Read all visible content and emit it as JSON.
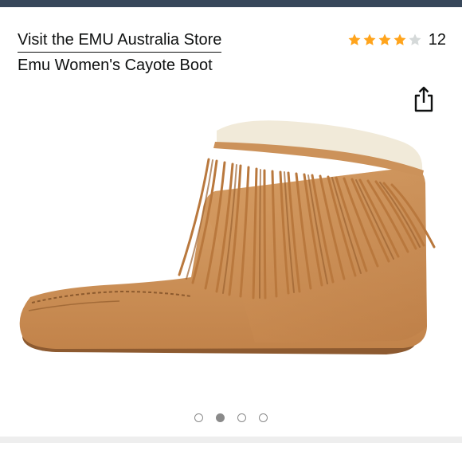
{
  "store": {
    "link_label": "Visit the EMU Australia Store"
  },
  "product": {
    "title": "Emu Women's Cayote Boot",
    "image_alt": "Chestnut suede fringe moccasin ankle boot"
  },
  "rating": {
    "stars": 4,
    "max_stars": 5,
    "count": "12",
    "star_color": "#ffa41c",
    "empty_star_color": "#d5d9d9"
  },
  "share": {
    "icon": "share-icon"
  },
  "carousel": {
    "count": 4,
    "active_index": 1
  }
}
